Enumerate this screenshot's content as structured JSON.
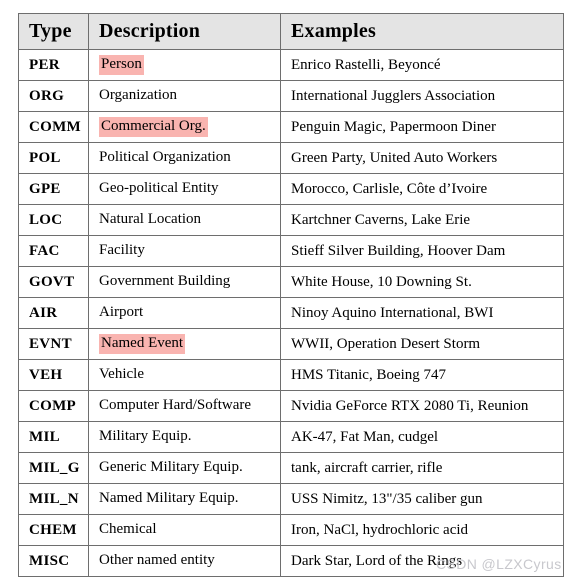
{
  "table": {
    "headers": [
      "Type",
      "Description",
      "Examples"
    ],
    "rows": [
      {
        "type": "PER",
        "description": "Person",
        "highlight": true,
        "examples": "Enrico Rastelli, Beyoncé"
      },
      {
        "type": "ORG",
        "description": "Organization",
        "highlight": false,
        "examples": "International Jugglers Association"
      },
      {
        "type": "COMM",
        "description": "Commercial Org.",
        "highlight": true,
        "examples": "Penguin Magic, Papermoon Diner"
      },
      {
        "type": "POL",
        "description": "Political Organization",
        "highlight": false,
        "examples": "Green Party, United Auto Workers"
      },
      {
        "type": "GPE",
        "description": "Geo-political Entity",
        "highlight": false,
        "examples": "Morocco, Carlisle, Côte d’Ivoire"
      },
      {
        "type": "LOC",
        "description": "Natural Location",
        "highlight": false,
        "examples": "Kartchner Caverns, Lake Erie"
      },
      {
        "type": "FAC",
        "description": "Facility",
        "highlight": false,
        "examples": "Stieff Silver Building, Hoover Dam"
      },
      {
        "type": "GOVT",
        "description": "Government Building",
        "highlight": false,
        "examples": "White House, 10 Downing St."
      },
      {
        "type": "AIR",
        "description": "Airport",
        "highlight": false,
        "examples": "Ninoy Aquino International, BWI"
      },
      {
        "type": "EVNT",
        "description": "Named Event",
        "highlight": true,
        "examples": "WWII, Operation Desert Storm"
      },
      {
        "type": "VEH",
        "description": "Vehicle",
        "highlight": false,
        "examples": "HMS Titanic, Boeing 747"
      },
      {
        "type": "COMP",
        "description": "Computer Hard/Software",
        "highlight": false,
        "examples": "Nvidia GeForce RTX 2080 Ti, Reunion"
      },
      {
        "type": "MIL",
        "description": "Military Equip.",
        "highlight": false,
        "examples": "AK-47, Fat Man, cudgel"
      },
      {
        "type": "MIL_G",
        "description": "Generic Military Equip.",
        "highlight": false,
        "examples": "tank, aircraft carrier, rifle"
      },
      {
        "type": "MIL_N",
        "description": "Named Military Equip.",
        "highlight": false,
        "examples": "USS Nimitz, 13\"/35 caliber gun"
      },
      {
        "type": "CHEM",
        "description": "Chemical",
        "highlight": false,
        "examples": "Iron, NaCl, hydrochloric acid"
      },
      {
        "type": "MISC",
        "description": "Other named entity",
        "highlight": false,
        "examples": "Dark Star, Lord of the Rings"
      }
    ]
  },
  "watermark": {
    "text": "CSDN @LZXCyrus"
  },
  "colors": {
    "highlight": "#f9b4b0",
    "header_background": "#e4e4e4",
    "border": "#6e6e6e",
    "text": "#000000",
    "watermark": "#c8c8cd"
  }
}
